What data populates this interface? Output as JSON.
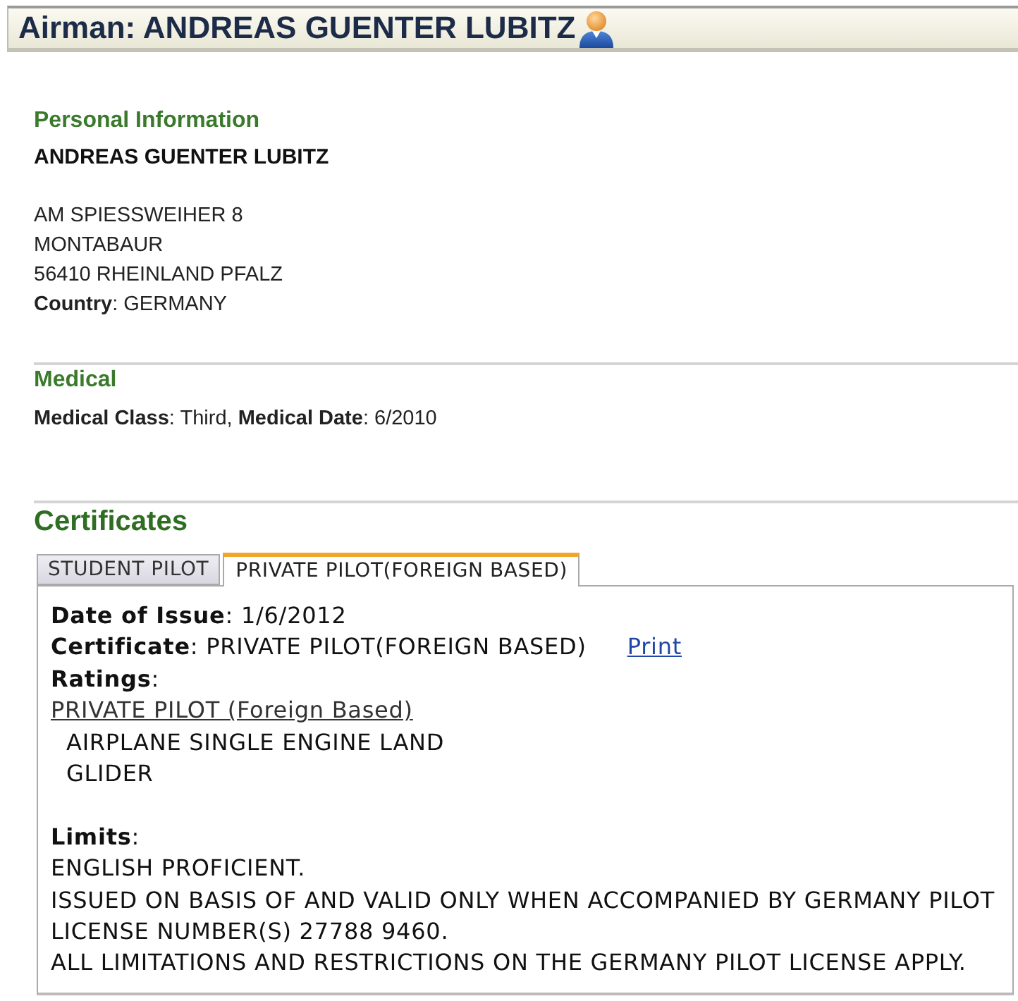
{
  "title_bar": {
    "title": "Airman: ANDREAS GUENTER LUBITZ"
  },
  "personal_information": {
    "heading": "Personal Information",
    "name": "ANDREAS GUENTER LUBITZ",
    "address_lines": [
      "AM SPIESSWEIHER 8",
      "MONTABAUR",
      "56410 RHEINLAND PFALZ"
    ],
    "country": "**Country**: GERMANY"
  },
  "medical": {
    "heading": "Medical",
    "details": "**Medical Class**: Third, **Medical Date**: 6/2010"
  },
  "certificates": {
    "heading": "Certificates",
    "tabs": [
      {
        "label": "STUDENT PILOT",
        "selected": false
      },
      {
        "label": "PRIVATE PILOT(FOREIGN BASED)",
        "selected": true
      }
    ],
    "panel": {
      "date_of_issue": "**Date of Issue**: 1/6/2012",
      "certificate": "**Certificate**: PRIVATE PILOT(FOREIGN BASED)",
      "print_link": "Print",
      "ratings_label": "**Ratings**:",
      "ratings": [
        {
          "label": "PRIVATE PILOT (Foreign Based)",
          "children": [
            {
              "label": "AIRPLANE SINGLE ENGINE LAND"
            },
            {
              "label": "GLIDER"
            }
          ]
        }
      ],
      "limits_label": "**Limits**:",
      "limits": [
        "ENGLISH PROFICIENT.",
        "ISSUED ON BASIS OF AND VALID ONLY WHEN ACCOMPANIED BY GERMANY PILOT LICENSE NUMBER(S) 27788 9460.",
        "ALL LIMITATIONS AND RESTRICTIONS ON THE GERMANY PILOT LICENSE APPLY."
      ]
    }
  }
}
